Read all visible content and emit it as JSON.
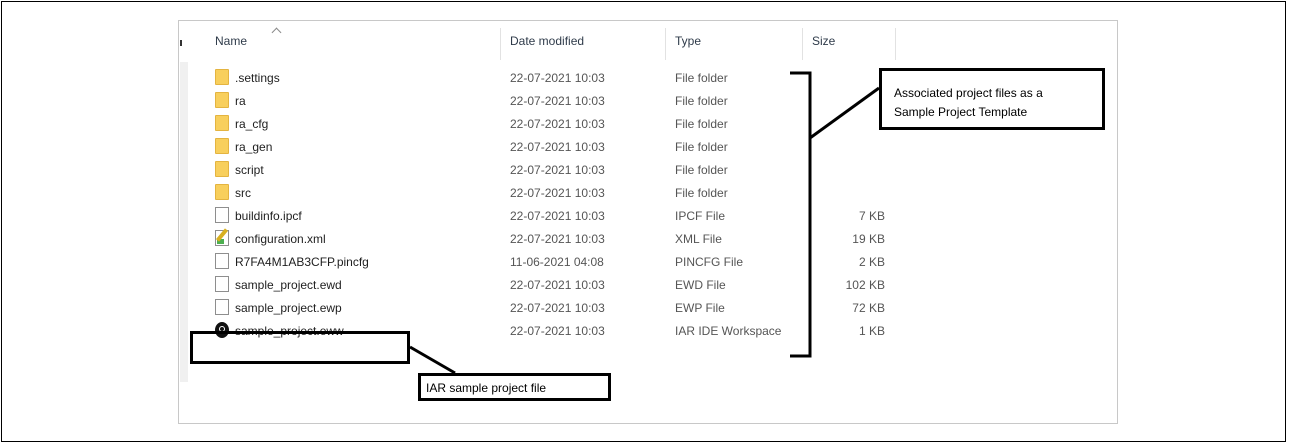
{
  "columns": {
    "name": "Name",
    "date": "Date modified",
    "type": "Type",
    "size": "Size"
  },
  "rows": [
    {
      "icon": "folder-icon",
      "name": ".settings",
      "date": "22-07-2021 10:03",
      "type": "File folder",
      "size": ""
    },
    {
      "icon": "folder-icon",
      "name": "ra",
      "date": "22-07-2021 10:03",
      "type": "File folder",
      "size": ""
    },
    {
      "icon": "folder-icon",
      "name": "ra_cfg",
      "date": "22-07-2021 10:03",
      "type": "File folder",
      "size": ""
    },
    {
      "icon": "folder-icon",
      "name": "ra_gen",
      "date": "22-07-2021 10:03",
      "type": "File folder",
      "size": ""
    },
    {
      "icon": "folder-icon",
      "name": "script",
      "date": "22-07-2021 10:03",
      "type": "File folder",
      "size": ""
    },
    {
      "icon": "folder-icon",
      "name": "src",
      "date": "22-07-2021 10:03",
      "type": "File folder",
      "size": ""
    },
    {
      "icon": "file-icon",
      "name": "buildinfo.ipcf",
      "date": "22-07-2021 10:03",
      "type": "IPCF File",
      "size": "7 KB"
    },
    {
      "icon": "xml-file-icon",
      "name": "configuration.xml",
      "date": "22-07-2021 10:03",
      "type": "XML File",
      "size": "19 KB"
    },
    {
      "icon": "file-icon",
      "name": "R7FA4M1AB3CFP.pincfg",
      "date": "11-06-2021 04:08",
      "type": "PINCFG File",
      "size": "2 KB"
    },
    {
      "icon": "file-icon",
      "name": "sample_project.ewd",
      "date": "22-07-2021 10:03",
      "type": "EWD File",
      "size": "102 KB"
    },
    {
      "icon": "file-icon",
      "name": "sample_project.ewp",
      "date": "22-07-2021 10:03",
      "type": "EWP File",
      "size": "72 KB"
    },
    {
      "icon": "iar-workspace-icon",
      "name": "sample_project.eww",
      "date": "22-07-2021 10:03",
      "type": "IAR IDE Workspace",
      "size": "1 KB"
    }
  ],
  "annotations": {
    "associated_line1": "Associated project files as a",
    "associated_line2": "Sample Project Template",
    "iar_label": "IAR sample project file"
  }
}
